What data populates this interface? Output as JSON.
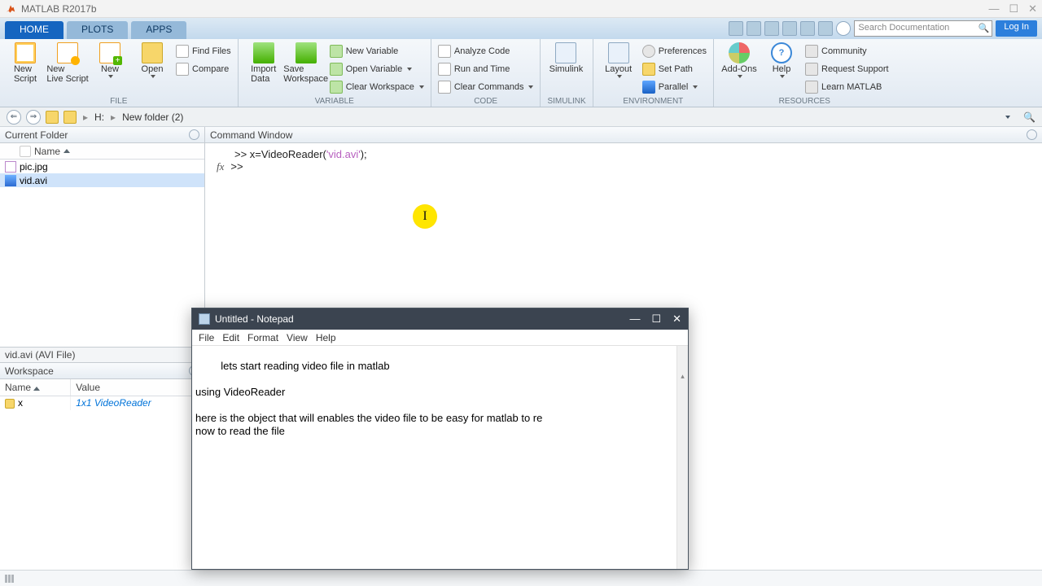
{
  "titlebar": {
    "title": "MATLAB R2017b"
  },
  "tabs": {
    "home": "HOME",
    "plots": "PLOTS",
    "apps": "APPS"
  },
  "qat": {
    "search_placeholder": "Search Documentation",
    "login": "Log In"
  },
  "toolstrip": {
    "file": {
      "new_script": "New\nScript",
      "new_live": "New\nLive Script",
      "new": "New",
      "open": "Open",
      "find_files": "Find Files",
      "compare": "Compare",
      "group": "FILE"
    },
    "variable": {
      "import": "Import\nData",
      "save_ws": "Save\nWorkspace",
      "new_var": "New Variable",
      "open_var": "Open Variable",
      "clear_ws": "Clear Workspace",
      "group": "VARIABLE"
    },
    "code": {
      "analyze": "Analyze Code",
      "run_time": "Run and Time",
      "clear_cmd": "Clear Commands",
      "group": "CODE"
    },
    "simulink": {
      "btn": "Simulink",
      "group": "SIMULINK"
    },
    "env": {
      "layout": "Layout",
      "prefs": "Preferences",
      "setpath": "Set Path",
      "parallel": "Parallel",
      "group": "ENVIRONMENT"
    },
    "res": {
      "addons": "Add-Ons",
      "help": "Help",
      "community": "Community",
      "support": "Request Support",
      "learn": "Learn MATLAB",
      "group": "RESOURCES"
    }
  },
  "address": {
    "drive": "H:",
    "folder": "New folder (2)"
  },
  "currentfolder": {
    "title": "Current Folder",
    "col": "Name",
    "files": [
      "pic.jpg",
      "vid.avi"
    ],
    "selected": "vid.avi",
    "details": "vid.avi  (AVI File)"
  },
  "workspace": {
    "title": "Workspace",
    "cols": {
      "name": "Name",
      "value": "Value"
    },
    "row": {
      "name": "x",
      "value": "1x1 VideoReader"
    }
  },
  "cmdwin": {
    "title": "Command Window",
    "line1_pre": ">> x=VideoReader(",
    "line1_str": "'vid.avi'",
    "line1_post": ");",
    "line2": ">> "
  },
  "notepad": {
    "title": "Untitled - Notepad",
    "menu": {
      "file": "File",
      "edit": "Edit",
      "format": "Format",
      "view": "View",
      "help": "Help"
    },
    "body": "lets start reading video file in matlab\n\nusing VideoReader\n\nhere is the object that will enables the video file to be easy for matlab to re\nnow to read the file"
  }
}
